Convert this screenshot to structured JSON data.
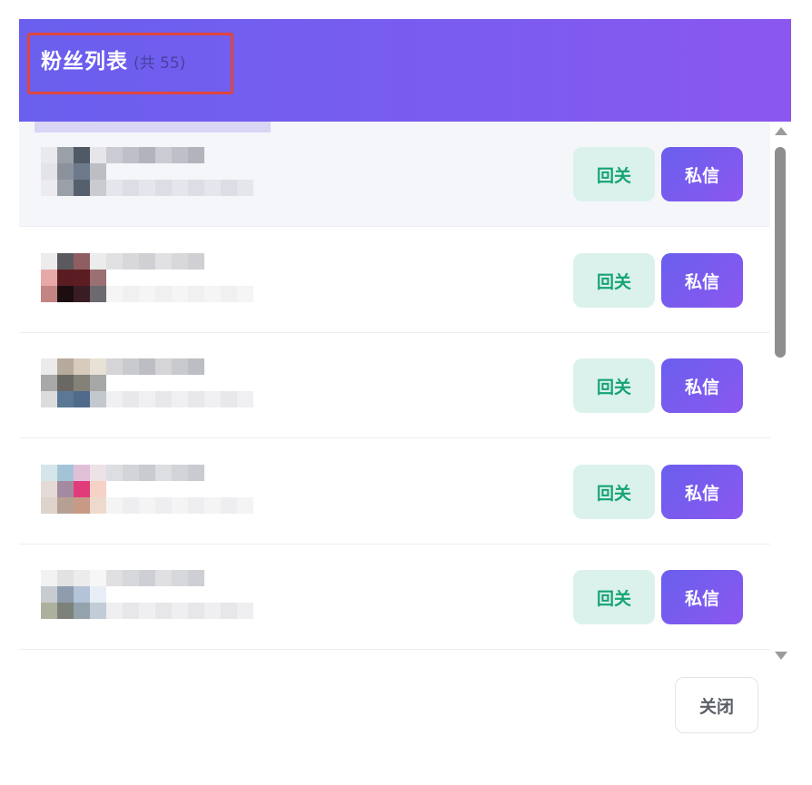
{
  "dialog": {
    "title": "粉丝列表",
    "count_text": "(共 55)",
    "close_label": "关闭"
  },
  "fans": [
    {
      "follow_label": "回关",
      "dm_label": "私信",
      "highlighted": true,
      "avatar": [
        [
          "#e9e9ee",
          "#9aa0a8",
          "#4f5a66",
          "#e6e6ea"
        ],
        [
          "#e3e3e8",
          "#8b929b",
          "#6c7a8c",
          "#bdbec3"
        ],
        [
          "#ececf0",
          "#9aa0a8",
          "#55606c",
          "#c9cbd0"
        ]
      ],
      "name_color": "#a6a8b2",
      "sub_color": "#dadbe2"
    },
    {
      "follow_label": "回关",
      "dm_label": "私信",
      "highlighted": false,
      "avatar": [
        [
          "#ececec",
          "#5a5a5e",
          "#8e5e62",
          "#ececec"
        ],
        [
          "#e9a8a8",
          "#5a1c22",
          "#5c1d22",
          "#9b7072"
        ],
        [
          "#c38484",
          "#1c0e10",
          "#391d22",
          "#6c6a6e"
        ]
      ],
      "name_color": "#c8c8cc",
      "sub_color": "#eeeeef"
    },
    {
      "follow_label": "回关",
      "dm_label": "私信",
      "highlighted": false,
      "avatar": [
        [
          "#eceaea",
          "#b6aa9c",
          "#d8cbbd",
          "#e8e2d6"
        ],
        [
          "#a8a8a8",
          "#6a6862",
          "#848278",
          "#a6a8a8"
        ],
        [
          "#dcdcdc",
          "#5a7896",
          "#506a8c",
          "#c3c8ce"
        ]
      ],
      "name_color": "#b2b3b8",
      "sub_color": "#e6e6ea"
    },
    {
      "follow_label": "回关",
      "dm_label": "私信",
      "highlighted": false,
      "avatar": [
        [
          "#d4e6ea",
          "#a3c4d6",
          "#e0c0d8",
          "#ede2e6"
        ],
        [
          "#e4dad6",
          "#a48aa0",
          "#e03c7c",
          "#f6d2c6"
        ],
        [
          "#ddd3ca",
          "#b6a094",
          "#c89a86",
          "#eedacc"
        ]
      ],
      "name_color": "#c0c2c8",
      "sub_color": "#ececef"
    },
    {
      "follow_label": "回关",
      "dm_label": "私信",
      "highlighted": false,
      "avatar": [
        [
          "#f2f2f2",
          "#e2e2e2",
          "#ececec",
          "#f6f6f6"
        ],
        [
          "#c8ccd0",
          "#8e9cae",
          "#b4c4d8",
          "#e8eef6"
        ],
        [
          "#acb09e",
          "#7c827a",
          "#94a2ac",
          "#c2ccd6"
        ]
      ],
      "name_color": "#c6c7cc",
      "sub_color": "#e4e4e8"
    }
  ],
  "scrollbar": {
    "thumb_fraction": 0.39,
    "position_fraction": 0.0
  },
  "colors": {
    "header_start": "#6a5fee",
    "header_end": "#8b57ef",
    "follow_bg": "#dbf2ec",
    "follow_text": "#16a374",
    "highlight_border": "#e0453c"
  },
  "icons": {
    "scroll_up": "triangle-up-icon",
    "scroll_down": "triangle-down-icon"
  }
}
